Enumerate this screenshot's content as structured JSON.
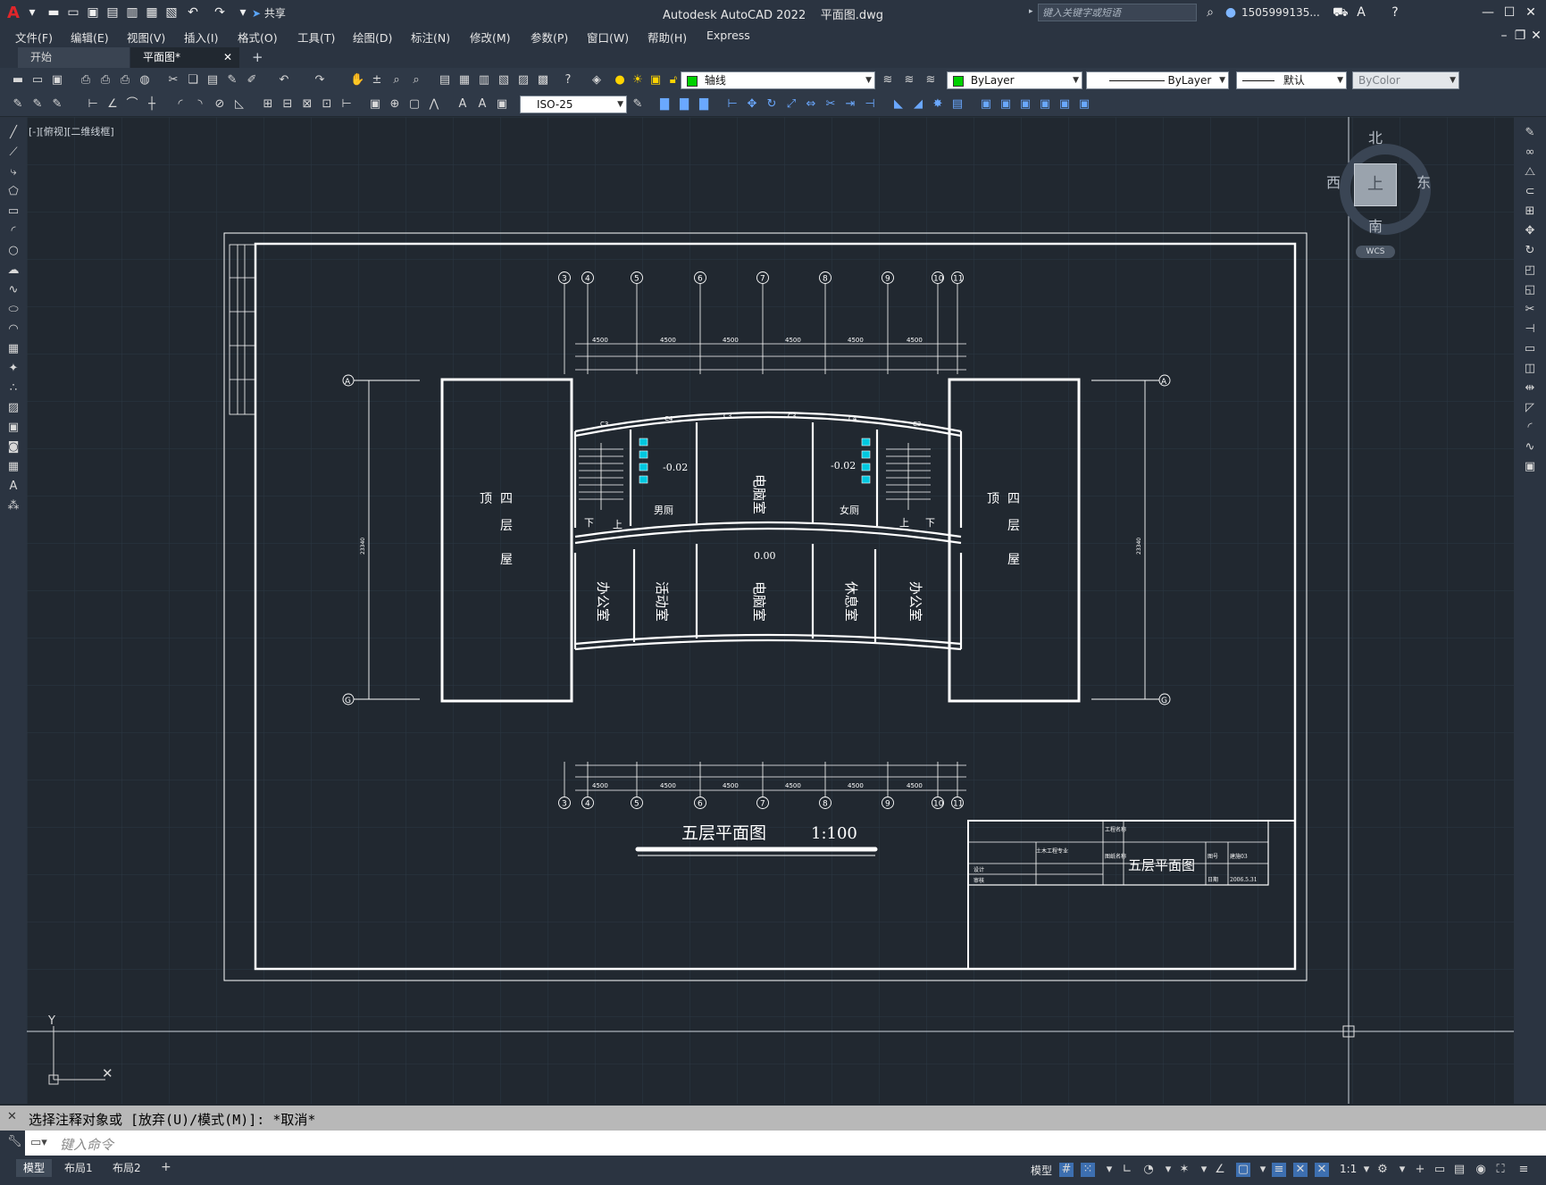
{
  "app": {
    "title": "Autodesk AutoCAD 2022",
    "file": "平面图.dwg",
    "share": "共享",
    "search_placeholder": "键入关键字或短语",
    "user": "1505999135...",
    "help": "?"
  },
  "menu": [
    "文件(F)",
    "编辑(E)",
    "视图(V)",
    "插入(I)",
    "格式(O)",
    "工具(T)",
    "绘图(D)",
    "标注(N)",
    "修改(M)",
    "参数(P)",
    "窗口(W)",
    "帮助(H)",
    "Express"
  ],
  "tabs": [
    {
      "label": "开始"
    },
    {
      "label": "平面图*"
    }
  ],
  "toolbar": {
    "layer": "轴线",
    "color": "ByLayer",
    "linetype": "ByLayer",
    "lineweight": "默认",
    "plotstyle": "ByColor",
    "dimstyle": "ISO-25"
  },
  "viewport_label": "[-][俯视][二维线框]",
  "viewcube": {
    "north": "北",
    "south": "南",
    "east": "东",
    "west": "西",
    "top": "上",
    "wcs": "WCS"
  },
  "drawing": {
    "plan_title": "五层平面图",
    "scale": "1:100",
    "top_axes": [
      "3",
      "4",
      "5",
      "6",
      "7",
      "8",
      "9",
      "10",
      "11"
    ],
    "dims_top": [
      "4500",
      "4500",
      "4500",
      "4500",
      "4500",
      "4500"
    ],
    "row_labels": [
      "A",
      "G"
    ],
    "height_dim": "23340",
    "rooms": {
      "computer_upper": "电脑室",
      "computer_lower": "电脑室",
      "office_left": "办公室",
      "office_right": "办公室",
      "activity": "活动室",
      "rest": "休息室",
      "male_wc": "男厕",
      "female_wc": "女厕",
      "roof_left": [
        "四",
        "层",
        "顶",
        "屋"
      ],
      "roof_right": [
        "四",
        "层",
        "顶",
        "屋"
      ],
      "up": "上",
      "down": "下"
    },
    "levels": {
      "wc_left": "-0.02",
      "wc_right": "-0.02",
      "corridor": "0.00"
    },
    "window_tags": [
      "C3",
      "C4",
      "C3",
      "C3",
      "C4",
      "C3"
    ],
    "title_block": {
      "drawing_name": "五层平面图",
      "project_name": "工程名称",
      "drawing_label": "图纸名称",
      "school": "土木工程专业",
      "drawn": "设计",
      "check": "审核",
      "date_label": "日期",
      "date": "2006.5.31",
      "number_label": "图号",
      "number": "建施03"
    }
  },
  "command": {
    "history": "选择注释对象或 [放弃(U)/模式(M)]: *取消*",
    "placeholder": "键入命令"
  },
  "layout_tabs": [
    "模型",
    "布局1",
    "布局2"
  ],
  "status": {
    "model": "模型",
    "scale": "1:1"
  }
}
